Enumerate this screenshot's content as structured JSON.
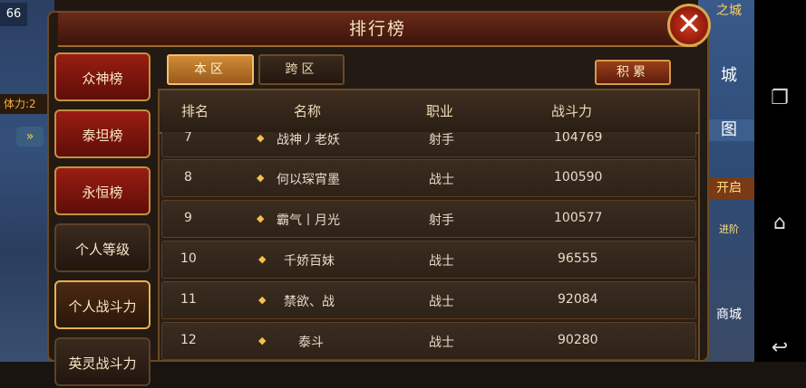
{
  "hud": {
    "level": "66",
    "stamina": "体力:2",
    "bottom_left": "",
    "right_labels": [
      "之城",
      "城",
      "图",
      "开启",
      "进阶",
      "商城"
    ]
  },
  "panel": {
    "title": "排行榜",
    "close_glyph": "✕"
  },
  "categories": [
    {
      "label": "众神榜",
      "style": "red"
    },
    {
      "label": "泰坦榜",
      "style": "red"
    },
    {
      "label": "永恒榜",
      "style": "red"
    },
    {
      "label": "个人等级",
      "style": "dark"
    },
    {
      "label": "个人战斗力",
      "style": "active"
    },
    {
      "label": "英灵战斗力",
      "style": "dark"
    }
  ],
  "tabs": {
    "local": "本区",
    "cross": "跨区",
    "points": "积累"
  },
  "table": {
    "columns": [
      "排名",
      "名称",
      "职业",
      "战斗力"
    ],
    "rows": [
      {
        "rank": "7",
        "name": "战神丿老妖",
        "job": "射手",
        "power": "104769"
      },
      {
        "rank": "8",
        "name": "何以琛宵墨",
        "job": "战士",
        "power": "100590"
      },
      {
        "rank": "9",
        "name": "霸气丨月光",
        "job": "射手",
        "power": "100577"
      },
      {
        "rank": "10",
        "name": "千娇百妹",
        "job": "战士",
        "power": "96555"
      },
      {
        "rank": "11",
        "name": "禁欲、战",
        "job": "战士",
        "power": "92084"
      },
      {
        "rank": "12",
        "name": "泰斗",
        "job": "战士",
        "power": "90280"
      }
    ]
  },
  "colors": {
    "accent": "#d08b36",
    "header_red": "#6a2a18",
    "close_red": "#d23a1e"
  },
  "icons": {
    "row_marker": "gem-icon",
    "nav": [
      "recent-apps-icon",
      "home-icon",
      "back-icon"
    ]
  }
}
